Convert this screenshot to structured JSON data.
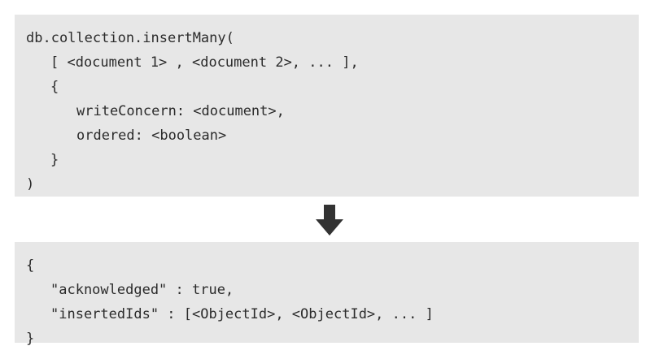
{
  "insert_many_syntax": {
    "lines": [
      "db.collection.insertMany(",
      "[ <document 1> , <document 2>, ... ],",
      "{",
      "writeConcern: <document>,",
      "ordered: <boolean>",
      "}",
      ")"
    ]
  },
  "arrow": {
    "icon": "down-arrow-icon",
    "color": "#333333"
  },
  "result_document": {
    "lines": [
      "{",
      "\"acknowledged\" : true,",
      "\"insertedIds\" : [<ObjectId>, <ObjectId>, ... ]",
      "}"
    ]
  }
}
